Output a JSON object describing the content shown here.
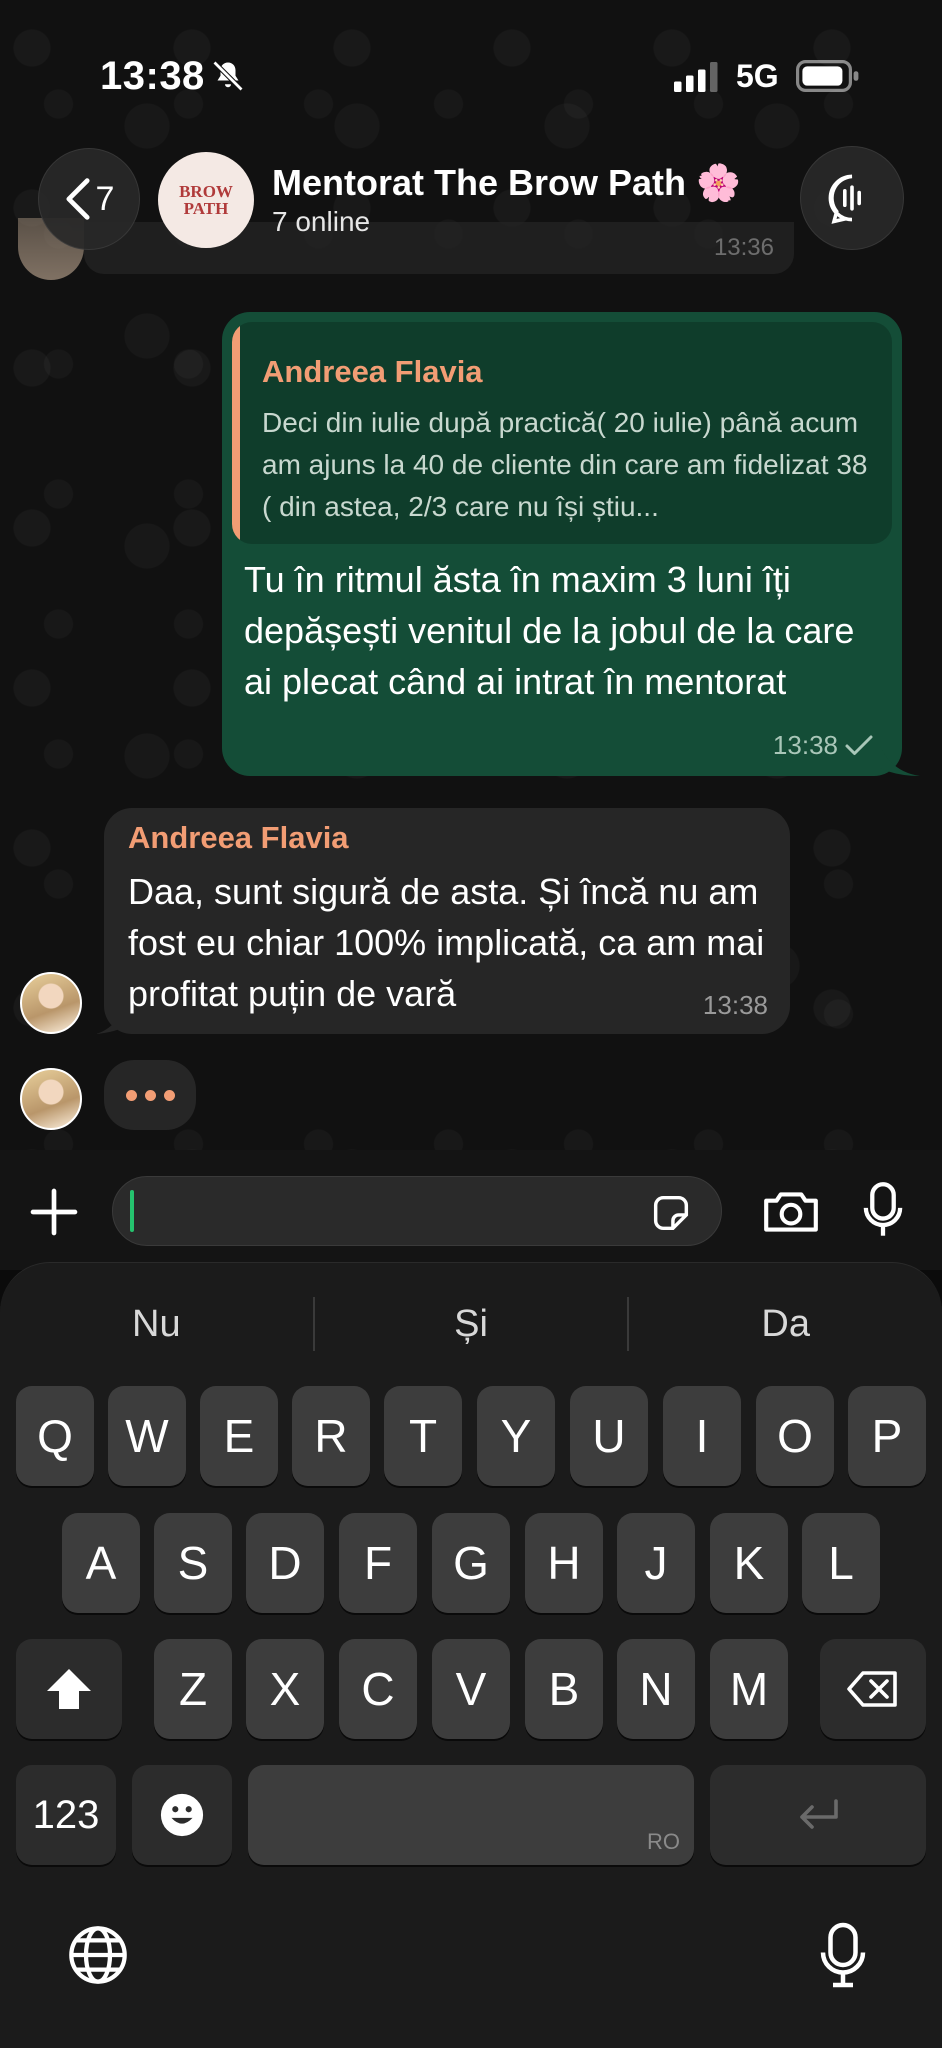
{
  "status_bar": {
    "time": "13:38",
    "network": "5G",
    "icons": [
      "bell-slash-icon",
      "signal-icon",
      "battery-icon"
    ]
  },
  "header": {
    "back_count": "7",
    "avatar_text_top": "BROW",
    "avatar_text_bottom": "PATH",
    "title": "Mentorat The Brow Path 🌸",
    "status": "7 online"
  },
  "previous_message": {
    "time": "13:36"
  },
  "outgoing_message": {
    "quote_author": "Andreea Flavia",
    "quote_text": "Deci din iulie după practică( 20 iulie) până acum am ajuns la 40 de cliente din care am fidelizat 38 ( din astea, 2/3 care nu își știu...",
    "text": "Tu în ritmul ăsta în maxim 3 luni îți depășești venitul de la jobul de la care ai plecat când ai intrat în mentorat",
    "time": "13:38",
    "status": "sent"
  },
  "incoming_message": {
    "author": "Andreea Flavia",
    "text": "Daa, sunt sigură de asta. Și încă nu am fost eu chiar 100% implicată, ca am mai profitat puțin de vară",
    "time": "13:38"
  },
  "input": {
    "value": "",
    "placeholder": ""
  },
  "keyboard": {
    "suggestions": [
      "Nu",
      "Și",
      "Da"
    ],
    "row1": [
      "Q",
      "W",
      "E",
      "R",
      "T",
      "Y",
      "U",
      "I",
      "O",
      "P"
    ],
    "row2": [
      "A",
      "S",
      "D",
      "F",
      "G",
      "H",
      "J",
      "K",
      "L"
    ],
    "row3": [
      "Z",
      "X",
      "C",
      "V",
      "B",
      "N",
      "M"
    ],
    "numbers_label": "123",
    "space_label": "RO"
  },
  "colors": {
    "outgoing_bubble": "#144d37",
    "incoming_bubble": "#262626",
    "author_accent": "#f29d74"
  }
}
